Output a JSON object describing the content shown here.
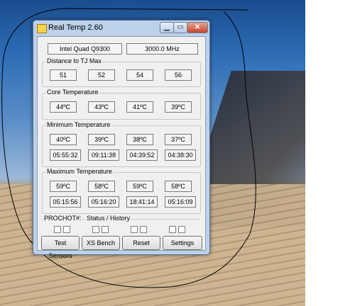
{
  "window": {
    "title": "Real Temp 2.60",
    "min_glyph": "▁",
    "max_glyph": "▭",
    "close_glyph": "✕"
  },
  "cpu": {
    "model": "Intel Quad Q9300",
    "speed": "3000.0 MHz"
  },
  "distance": {
    "label": "Distance to TJ Max",
    "values": [
      "51",
      "52",
      "54",
      "56"
    ]
  },
  "core": {
    "label": "Core Temperature",
    "values": [
      "44ºC",
      "43ºC",
      "41ºC",
      "39ºC"
    ]
  },
  "minimum": {
    "label": "Minimum Temperature",
    "temps": [
      "40ºC",
      "39ºC",
      "38ºC",
      "37ºC"
    ],
    "times": [
      "05:55:32",
      "09:11:38",
      "04:39:52",
      "04:38:30"
    ]
  },
  "maximum": {
    "label": "Maximum Temperature",
    "temps": [
      "59ºC",
      "58ºC",
      "59ºC",
      "58ºC"
    ],
    "times": [
      "05:15:56",
      "05:16:20",
      "18:41:14",
      "05:16:09"
    ]
  },
  "prochot": {
    "label": "PROCHOT#:",
    "status_label": "Status / History"
  },
  "buttons": {
    "test_sensors": "Test Sensors",
    "xs_bench": "XS Bench",
    "reset": "Reset",
    "settings": "Settings"
  },
  "colors": {
    "desktop_sky": "#2e6db5",
    "window_frame": "#bcd1ea",
    "client_bg": "#f0f0f0",
    "lasso_line": "#000000"
  }
}
